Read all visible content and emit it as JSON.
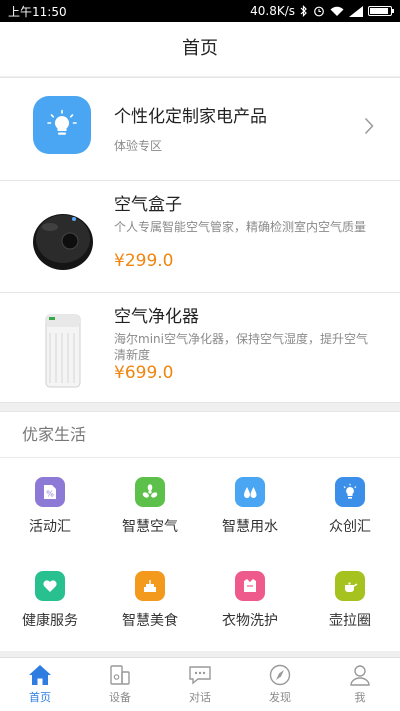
{
  "status_bar": {
    "time": "上午11:50",
    "net_speed": "40.8K/s",
    "battery_level": 0.9
  },
  "header": {
    "title": "首页"
  },
  "promo": {
    "title": "个性化定制家电产品",
    "subtitle": "体验专区",
    "icon": "lightbulb-icon",
    "icon_bg": "#4aa6f2"
  },
  "products": [
    {
      "name": "空气盒子",
      "desc": "个人专属智能空气管家，精确检测室内空气质量",
      "price": "¥299.0"
    },
    {
      "name": "空气净化器",
      "desc": "海尔mini空气净化器，保持空气湿度，提升空气清新度",
      "price": "¥699.0"
    }
  ],
  "section": {
    "title": "优家生活",
    "items": [
      {
        "label": "活动汇",
        "icon": "discount-icon",
        "color": "#8c7ad6"
      },
      {
        "label": "智慧空气",
        "icon": "fan-icon",
        "color": "#5dc04a"
      },
      {
        "label": "智慧用水",
        "icon": "water-drops-icon",
        "color": "#4aa6f2"
      },
      {
        "label": "众创汇",
        "icon": "lightbulb-icon",
        "color": "#3b8fe8"
      },
      {
        "label": "健康服务",
        "icon": "heart-icon",
        "color": "#27c08e"
      },
      {
        "label": "智慧美食",
        "icon": "cake-icon",
        "color": "#f39a1c"
      },
      {
        "label": "衣物洗护",
        "icon": "shirt-icon",
        "color": "#ef5a8c"
      },
      {
        "label": "壶拉圈",
        "icon": "teapot-icon",
        "color": "#a6c21e"
      }
    ]
  },
  "tabs": [
    {
      "label": "首页",
      "icon": "home-icon",
      "active": true
    },
    {
      "label": "设备",
      "icon": "devices-icon",
      "active": false
    },
    {
      "label": "对话",
      "icon": "chat-icon",
      "active": false
    },
    {
      "label": "发现",
      "icon": "compass-icon",
      "active": false
    },
    {
      "label": "我",
      "icon": "user-icon",
      "active": false
    }
  ],
  "colors": {
    "accent": "#2f7de1",
    "price": "#f0850f"
  }
}
